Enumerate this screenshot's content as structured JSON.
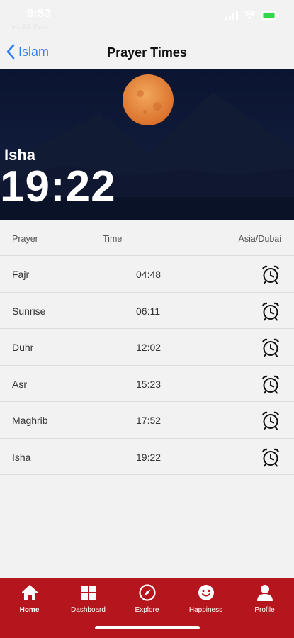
{
  "status_bar": {
    "time": "9:53",
    "carrier": "◂ UAE Pass"
  },
  "nav": {
    "back_label": "Islam",
    "title": "Prayer Times"
  },
  "hero": {
    "prayer": "Isha",
    "time": "19:22"
  },
  "table": {
    "headers": {
      "prayer": "Prayer",
      "time": "Time",
      "timezone": "Asia/Dubai"
    },
    "rows": [
      {
        "name": "Fajr",
        "time": "04:48"
      },
      {
        "name": "Sunrise",
        "time": "06:11"
      },
      {
        "name": "Duhr",
        "time": "12:02"
      },
      {
        "name": "Asr",
        "time": "15:23"
      },
      {
        "name": "Maghrib",
        "time": "17:52"
      },
      {
        "name": "Isha",
        "time": "19:22"
      }
    ]
  },
  "tabs": [
    {
      "label": "Home",
      "icon": "home-icon",
      "active": true
    },
    {
      "label": "Dashboard",
      "icon": "dashboard-icon",
      "active": false
    },
    {
      "label": "Explore",
      "icon": "compass-icon",
      "active": false
    },
    {
      "label": "Happiness",
      "icon": "smiley-icon",
      "active": false
    },
    {
      "label": "Profile",
      "icon": "profile-icon",
      "active": false
    }
  ],
  "colors": {
    "accent": "#2f7cf6",
    "tab_bar": "#b5151c",
    "hero_sky": "#0d1836",
    "moon": "#e8873a"
  }
}
